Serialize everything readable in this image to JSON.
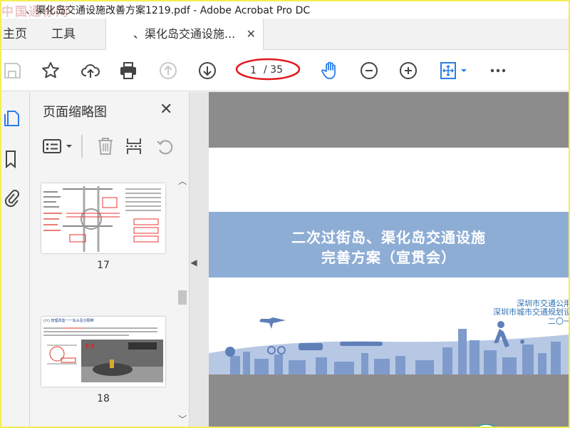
{
  "window": {
    "title": "、渠化岛交通设施改善方案1219.pdf - Adobe Acrobat Pro DC",
    "watermark": "中国通标网"
  },
  "tabs": [
    {
      "label": "主页"
    },
    {
      "label": "工具"
    },
    {
      "label": "、渠化岛交通设施...",
      "close": "✕"
    }
  ],
  "toolbar": {
    "current_page": "1",
    "total_pages": "/ 35",
    "icons": [
      "save-icon",
      "star-icon",
      "cloud-upload-icon",
      "print-icon",
      "page-up-icon",
      "page-down-icon",
      "hand-tool-icon",
      "zoom-out-icon",
      "zoom-in-icon",
      "fit-page-icon",
      "more-icon"
    ]
  },
  "panel": {
    "title": "页面缩略图",
    "close": "✕",
    "thumbnails": [
      {
        "page_label": "17"
      },
      {
        "page_label": "18",
        "heading": "(六) 管理改善一一车头及分隔带"
      }
    ]
  },
  "document": {
    "slide_title_line1": "二次过街岛、渠化岛交通设施",
    "slide_title_line2": "完善方案（宣贯会）",
    "org_line1": "深圳市交通公用",
    "org_line2": "深圳市城市交通规划设",
    "org_line3": "二〇一"
  },
  "colors": {
    "accent": "#2b7de9",
    "banner": "#8eadd5",
    "highlight_oval": "#e0191f",
    "window_border": "#f4ee54"
  }
}
